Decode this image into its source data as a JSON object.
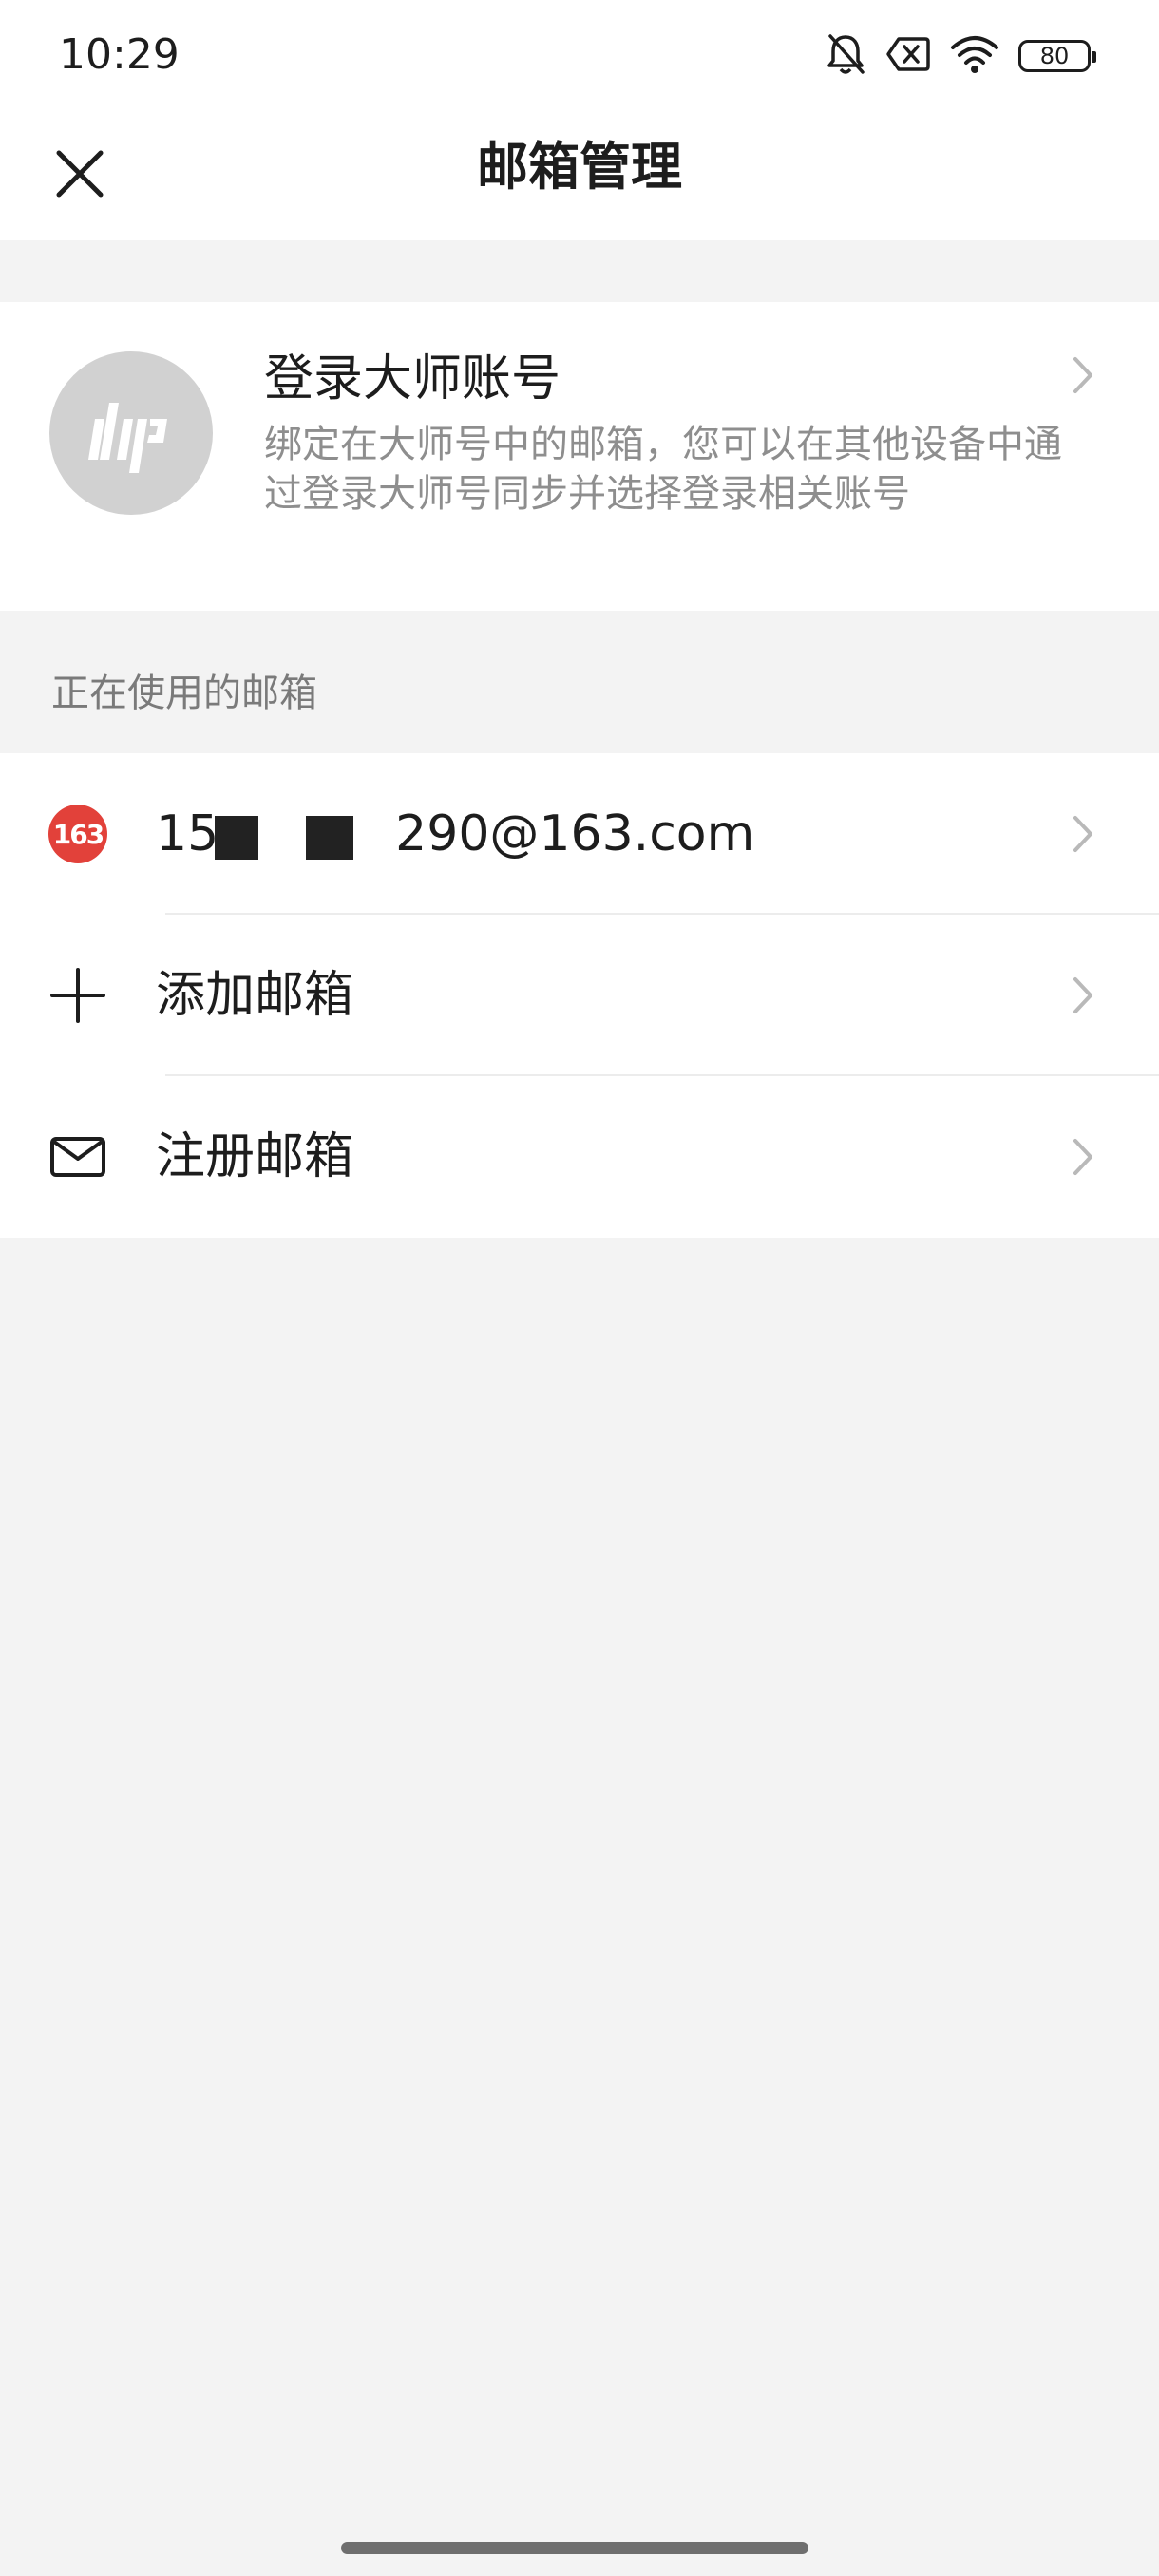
{
  "status_bar": {
    "time": "10:29",
    "battery": "80",
    "icons": [
      "bell-off-icon",
      "no-sim-icon",
      "wifi-icon",
      "battery-icon"
    ]
  },
  "title_bar": {
    "title": "邮箱管理",
    "close_icon": "close-icon"
  },
  "master_account": {
    "title": "登录大师账号",
    "description": "绑定在大师号中的邮箱，您可以在其他设备中通过登录大师号同步并选择登录相关账号"
  },
  "section": {
    "in_use_label": "正在使用的邮箱"
  },
  "list": {
    "email": {
      "prefix": "15",
      "suffix": "290@163.com",
      "badge": "163"
    },
    "add": {
      "label": "添加邮箱",
      "icon": "plus-icon"
    },
    "register": {
      "label": "注册邮箱",
      "icon": "mail-icon"
    }
  },
  "colors": {
    "background": "#f3f3f3",
    "card": "#ffffff",
    "badge_163": "#e2413a",
    "secondary_text": "#8e8e8e",
    "avatar": "#d1d1d1"
  }
}
